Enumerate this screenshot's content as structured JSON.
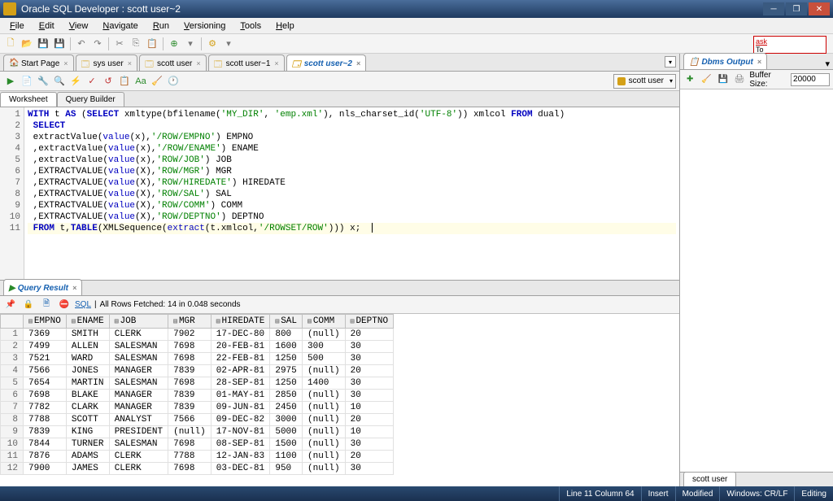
{
  "window": {
    "title": "Oracle SQL Developer : scott user~2"
  },
  "menu": [
    "File",
    "Edit",
    "View",
    "Navigate",
    "Run",
    "Versioning",
    "Tools",
    "Help"
  ],
  "ask": {
    "label": "ask",
    "sub": "To"
  },
  "tabs": [
    {
      "label": "Start Page",
      "icon": "home-icon"
    },
    {
      "label": "sys user",
      "icon": "sql-icon"
    },
    {
      "label": "scott user",
      "icon": "sql-icon"
    },
    {
      "label": "scott user~1",
      "icon": "sql-icon"
    },
    {
      "label": "scott user~2",
      "icon": "sql-icon",
      "active": true
    }
  ],
  "connection": "scott user",
  "subtabs": {
    "worksheet": "Worksheet",
    "querybuilder": "Query Builder"
  },
  "code": {
    "lines": [
      {
        "n": 1,
        "html": "<span class='kw'>WITH</span> t <span class='kw'>AS</span> (<span class='kw'>SELECT</span> xmltype(bfilename(<span class='str'>'MY_DIR'</span>, <span class='str'>'emp.xml'</span>), nls_charset_id(<span class='str'>'UTF-8'</span>)) xmlcol <span class='kw'>FROM</span> dual)"
      },
      {
        "n": 2,
        "html": " <span class='kw'>SELECT</span>"
      },
      {
        "n": 3,
        "html": " extractValue(<span class='fn'>value</span>(x),<span class='str'>'/ROW/EMPNO'</span>) EMPNO"
      },
      {
        "n": 4,
        "html": " ,extractValue(<span class='fn'>value</span>(x),<span class='str'>'/ROW/ENAME'</span>) ENAME"
      },
      {
        "n": 5,
        "html": " ,extractValue(<span class='fn'>value</span>(x),<span class='str'>'ROW/JOB'</span>) JOB"
      },
      {
        "n": 6,
        "html": " ,EXTRACTVALUE(<span class='fn'>value</span>(X),<span class='str'>'ROW/MGR'</span>) MGR"
      },
      {
        "n": 7,
        "html": " ,EXTRACTVALUE(<span class='fn'>value</span>(X),<span class='str'>'ROW/HIREDATE'</span>) HIREDATE"
      },
      {
        "n": 8,
        "html": " ,EXTRACTVALUE(<span class='fn'>value</span>(X),<span class='str'>'ROW/SAL'</span>) SAL"
      },
      {
        "n": 9,
        "html": " ,EXTRACTVALUE(<span class='fn'>value</span>(X),<span class='str'>'ROW/COMM'</span>) COMM"
      },
      {
        "n": 10,
        "html": " ,EXTRACTVALUE(<span class='fn'>value</span>(X),<span class='str'>'ROW/DEPTNO'</span>) DEPTNO"
      },
      {
        "n": 11,
        "html": " <span class='kw'>FROM</span> t,<span class='kw'>TABLE</span>(XMLSequence(<span class='fn'>extract</span>(t.xmlcol,<span class='str'>'/ROWSET/ROW'</span>))) x;  <span class='cursor'></span>",
        "hl": true
      }
    ]
  },
  "queryresult": {
    "tab": "Query Result",
    "sql": "SQL",
    "status": "All Rows Fetched: 14 in 0.048 seconds",
    "columns": [
      "EMPNO",
      "ENAME",
      "JOB",
      "MGR",
      "HIREDATE",
      "SAL",
      "COMM",
      "DEPTNO"
    ],
    "rows": [
      [
        "7369",
        "SMITH",
        "CLERK",
        "7902",
        "17-DEC-80",
        "800",
        "(null)",
        "20"
      ],
      [
        "7499",
        "ALLEN",
        "SALESMAN",
        "7698",
        "20-FEB-81",
        "1600",
        "300",
        "30"
      ],
      [
        "7521",
        "WARD",
        "SALESMAN",
        "7698",
        "22-FEB-81",
        "1250",
        "500",
        "30"
      ],
      [
        "7566",
        "JONES",
        "MANAGER",
        "7839",
        "02-APR-81",
        "2975",
        "(null)",
        "20"
      ],
      [
        "7654",
        "MARTIN",
        "SALESMAN",
        "7698",
        "28-SEP-81",
        "1250",
        "1400",
        "30"
      ],
      [
        "7698",
        "BLAKE",
        "MANAGER",
        "7839",
        "01-MAY-81",
        "2850",
        "(null)",
        "30"
      ],
      [
        "7782",
        "CLARK",
        "MANAGER",
        "7839",
        "09-JUN-81",
        "2450",
        "(null)",
        "10"
      ],
      [
        "7788",
        "SCOTT",
        "ANALYST",
        "7566",
        "09-DEC-82",
        "3000",
        "(null)",
        "20"
      ],
      [
        "7839",
        "KING",
        "PRESIDENT",
        "(null)",
        "17-NOV-81",
        "5000",
        "(null)",
        "10"
      ],
      [
        "7844",
        "TURNER",
        "SALESMAN",
        "7698",
        "08-SEP-81",
        "1500",
        "(null)",
        "30"
      ],
      [
        "7876",
        "ADAMS",
        "CLERK",
        "7788",
        "12-JAN-83",
        "1100",
        "(null)",
        "20"
      ],
      [
        "7900",
        "JAMES",
        "CLERK",
        "7698",
        "03-DEC-81",
        "950",
        "(null)",
        "30"
      ]
    ]
  },
  "dbms": {
    "tab": "Dbms Output",
    "buffersize_label": "Buffer Size:",
    "buffersize_value": "20000",
    "statusconn": "scott user"
  },
  "statusbar": {
    "pos": "Line 11 Column 64",
    "insert": "Insert",
    "mod": "Modified",
    "enc": "Windows: CR/LF",
    "edit": "Editing"
  }
}
